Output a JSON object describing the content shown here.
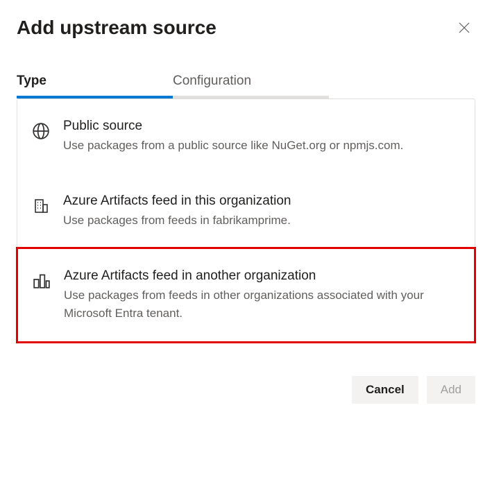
{
  "title": "Add upstream source",
  "tabs": {
    "type": "Type",
    "configuration": "Configuration"
  },
  "options": [
    {
      "title": "Public source",
      "desc": "Use packages from a public source like NuGet.org or npmjs.com."
    },
    {
      "title": "Azure Artifacts feed in this organization",
      "desc": "Use packages from feeds in fabrikamprime."
    },
    {
      "title": "Azure Artifacts feed in another organization",
      "desc": "Use packages from feeds in other organizations associated with your Microsoft Entra tenant."
    }
  ],
  "buttons": {
    "cancel": "Cancel",
    "add": "Add"
  }
}
